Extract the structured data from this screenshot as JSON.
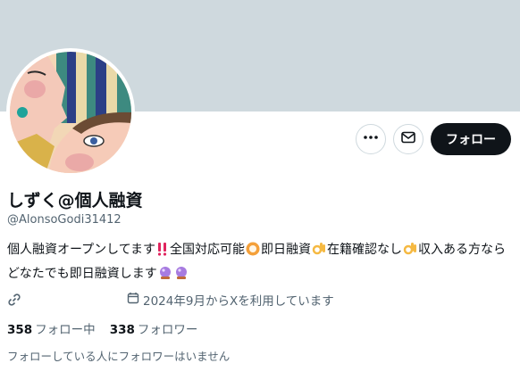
{
  "profile": {
    "name": "しずく@個人融資",
    "handle": "@AlonsoGodi31412",
    "bio": {
      "p1": "個人融資オープンしてます",
      "p2": "全国対応可能",
      "p3": "即日融資",
      "p4": "在籍確認なし",
      "p5": "収入ある方ならどなたでも即日融資します"
    },
    "joined": "2024年9月からXを利用しています",
    "following_count": "358",
    "following_label": "フォロー中",
    "followers_count": "338",
    "followers_label": "フォロワー",
    "followed_by": "フォローしている人にフォロワーはいません"
  },
  "actions": {
    "follow_label": "フォロー"
  },
  "icons": [
    "more-icon",
    "message-icon",
    "link-icon",
    "calendar-icon",
    "double-exclamation-icon",
    "ok-hand-icon",
    "crystal-ball-icon"
  ],
  "colors": {
    "banner": "#cfd9de",
    "follow_bg": "#0f1419",
    "muted": "#536471"
  }
}
